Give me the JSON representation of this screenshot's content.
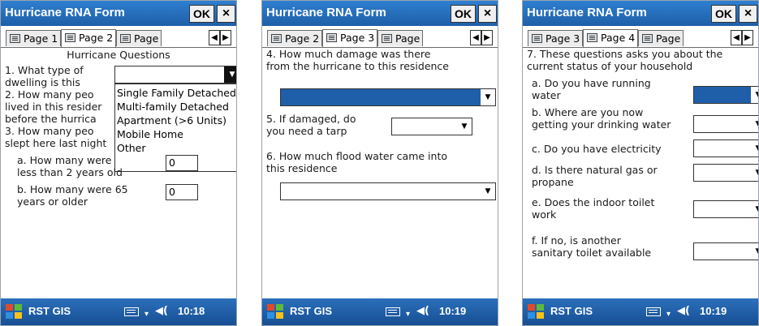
{
  "screens": [
    {
      "title": "Hurricane RNA Form",
      "ok_label": "OK",
      "close_label": "×",
      "tabs": [
        "Page 1",
        "Page 2",
        "Page"
      ],
      "active_tab": 1,
      "heading": "Hurricane Questions",
      "q1_line1": "1. What type of",
      "q1_line2": "dwelling is this",
      "q2_line1": "2. How many peo",
      "q2_line2": "lived in this resider",
      "q2_line3": "before the hurrica",
      "q3_line1": "3. How many peo",
      "q3_line2": "slept here last night",
      "qa_line1": "a. How many were",
      "qa_line2": "less than 2 years old",
      "qa_value": "0",
      "qb_line1": "b. How many were 65",
      "qb_line2": "years or older",
      "qb_value": "0",
      "dropdown_options": [
        "Single Family Detached",
        "Multi-family Detached",
        "Apartment (>6 Units)",
        "Mobile Home",
        "Other"
      ],
      "taskbar_label": "RST GIS",
      "time": "10:18"
    },
    {
      "title": "Hurricane RNA Form",
      "ok_label": "OK",
      "close_label": "×",
      "tabs": [
        "Page 2",
        "Page 3",
        "Page"
      ],
      "active_tab": 1,
      "q4_line1": "4. How much damage was there",
      "q4_line2": "from the hurricane to this residence",
      "q5_line1": "5. If damaged, do",
      "q5_line2": "you need a tarp",
      "q6_line1": "6. How much flood water came into",
      "q6_line2": "this residence",
      "taskbar_label": "RST GIS",
      "time": "10:19"
    },
    {
      "title": "Hurricane RNA Form",
      "ok_label": "OK",
      "close_label": "×",
      "tabs": [
        "Page 3",
        "Page 4",
        "Page"
      ],
      "active_tab": 1,
      "q7_line1": "7. These questions asks you about the",
      "q7_line2": "current status of your household",
      "qa_line1": "a. Do you have running",
      "qa_line2": "water",
      "qb_line1": "b. Where are you now",
      "qb_line2": "getting your drinking water",
      "qc_line1": "c. Do you have electricity",
      "qd_line1": "d. Is there natural gas or",
      "qd_line2": "propane",
      "qe_line1": "e. Does the indoor toilet",
      "qe_line2": "work",
      "qf_line1": "f. If no, is another",
      "qf_line2": "sanitary toilet available",
      "taskbar_label": "RST GIS",
      "time": "10:19"
    }
  ],
  "colors": {
    "titlebar": "#1e5fa8",
    "selection": "#1f5fa9",
    "taskbar": "#174f93"
  },
  "icons": {
    "start": "windows-flag-icon",
    "keyboard": "keyboard-icon",
    "volume": "speaker-icon"
  }
}
